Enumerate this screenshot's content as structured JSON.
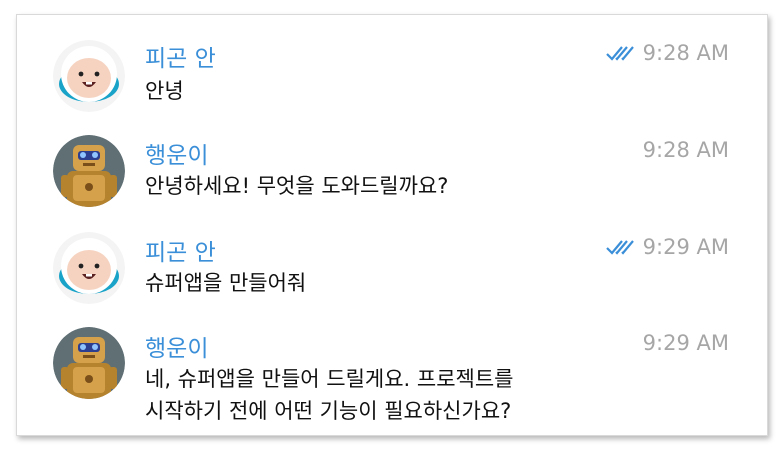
{
  "messages": [
    {
      "sender": "피곤 안",
      "avatar": "finn-avatar",
      "lines": [
        "안녕"
      ],
      "time": "9:28 AM",
      "read_receipt": "double-check-icon"
    },
    {
      "sender": "행운이",
      "avatar": "robot-avatar",
      "lines": [
        "안녕하세요! 무엇을 도와드릴까요?"
      ],
      "time": "9:28 AM",
      "read_receipt": null
    },
    {
      "sender": "피곤 안",
      "avatar": "finn-avatar",
      "lines": [
        "슈퍼앱을 만들어줘"
      ],
      "time": "9:29 AM",
      "read_receipt": "double-check-icon"
    },
    {
      "sender": "행운이",
      "avatar": "robot-avatar",
      "lines": [
        "네, 슈퍼앱을 만들어 드릴게요. 프로젝트를",
        "시작하기 전에 어떤 기능이 필요하신가요?"
      ],
      "time": "9:29 AM",
      "read_receipt": null
    }
  ],
  "colors": {
    "name": "#3a8fd8",
    "time": "#a6a6a6",
    "check": "#3a8fd8",
    "text": "#111111"
  }
}
